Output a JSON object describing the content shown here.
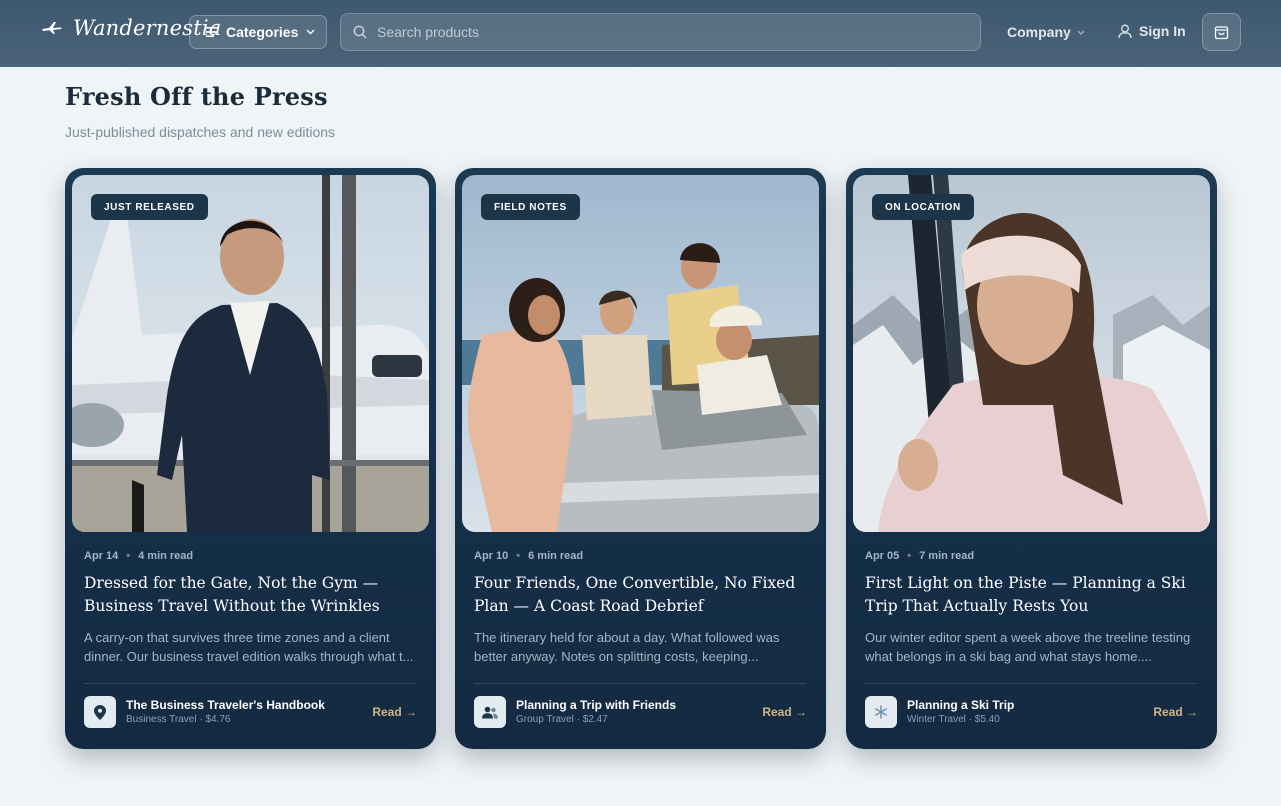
{
  "header": {
    "brand": "Wandernestia",
    "categories_label": "Categories",
    "search_placeholder": "Search products",
    "company_label": "Company",
    "signin_label": "Sign In"
  },
  "section": {
    "title": "Fresh Off the Press",
    "subtitle": "Just-published dispatches and new editions"
  },
  "cards": [
    {
      "badge": "JUST RELEASED",
      "date": "Apr 14",
      "read_time": "4 min read",
      "title": "Dressed for the Gate, Not the Gym — Business Travel Without the Wrinkles",
      "excerpt": "A carry-on that survives three time zones and a client dinner. Our business travel edition walks through what t...",
      "product_name": "The Business Traveler's Handbook",
      "product_meta": "Business Travel · $4.76",
      "product_icon": "location-pin-icon",
      "read_label": "Read →"
    },
    {
      "badge": "FIELD NOTES",
      "date": "Apr 10",
      "read_time": "6 min read",
      "title": "Four Friends, One Convertible, No Fixed Plan — A Coast Road Debrief",
      "excerpt": "The itinerary held for about a day. What followed was better anyway. Notes on splitting costs, keeping...",
      "product_name": "Planning a Trip with Friends",
      "product_meta": "Group Travel · $2.47",
      "product_icon": "users-icon",
      "read_label": "Read →"
    },
    {
      "badge": "ON LOCATION",
      "date": "Apr 05",
      "read_time": "7 min read",
      "title": "First Light on the Piste — Planning a Ski Trip That Actually Rests You",
      "excerpt": "Our winter editor spent a week above the treeline testing what belongs in a ski bag and what stays home....",
      "product_name": "Planning a Ski Trip",
      "product_meta": "Winter Travel · $5.40",
      "product_icon": "snowflake-icon",
      "read_label": "Read →"
    }
  ],
  "colors": {
    "header_bg": "#455e74",
    "page_bg": "#eff4f6",
    "card_bg": "#16304a",
    "accent_read": "#d4b384"
  }
}
